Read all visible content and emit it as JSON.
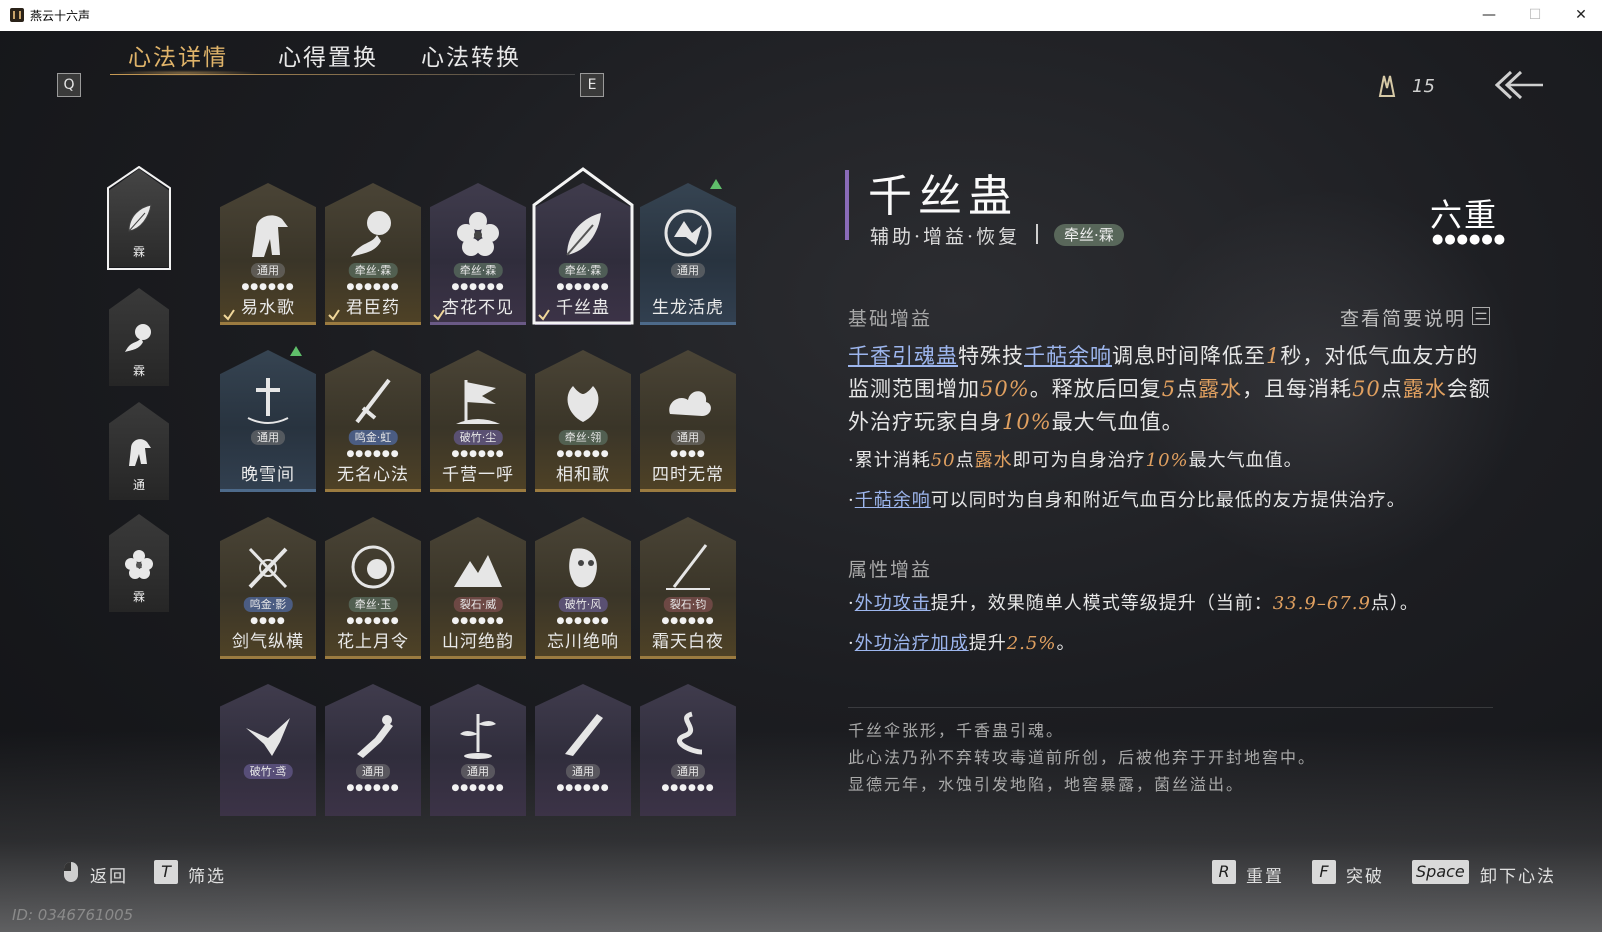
{
  "window": {
    "title": "燕云十六声",
    "minimize": "—",
    "maximize": "☐",
    "close": "✕"
  },
  "nav": {
    "key_left": "Q",
    "key_right": "E",
    "tabs": [
      {
        "label": "心法详情",
        "active": true
      },
      {
        "label": "心得置换",
        "active": false
      },
      {
        "label": "心法转换",
        "active": false
      }
    ],
    "currency": "15"
  },
  "left_slots": [
    {
      "label": "霖",
      "icon": "leaf-icon",
      "selected": true
    },
    {
      "label": "霖",
      "icon": "pouring-jar-icon",
      "selected": false
    },
    {
      "label": "通",
      "icon": "horse-icon",
      "selected": false
    },
    {
      "label": "霖",
      "icon": "flower-icon",
      "selected": false
    }
  ],
  "cards": [
    {
      "name": "易水歌",
      "tag": "通用",
      "dots": "●●●●●●",
      "icon": "horse-icon",
      "color": "gold",
      "tagc": "",
      "check": true
    },
    {
      "name": "君臣药",
      "tag": "牵丝·霖",
      "dots": "●●●●●●",
      "icon": "pouring-jar-icon",
      "color": "gold",
      "tagc": "green",
      "check": true
    },
    {
      "name": "杏花不见",
      "tag": "牵丝·霖",
      "dots": "●●●●●●",
      "icon": "flower-icon",
      "color": "purple",
      "tagc": "green",
      "check": true
    },
    {
      "name": "千丝蛊",
      "tag": "牵丝·霖",
      "dots": "●●●●●●",
      "icon": "leaf-icon",
      "color": "purple",
      "tagc": "green",
      "check": true,
      "selected": true
    },
    {
      "name": "生龙活虎",
      "tag": "通用",
      "dots": "",
      "icon": "dragon-emblem-icon",
      "color": "blue",
      "tagc": "",
      "up": true
    },
    {
      "name": "晚雪间",
      "tag": "通用",
      "dots": "",
      "icon": "sword-in-ground-icon",
      "color": "blue",
      "tagc": "",
      "up": true
    },
    {
      "name": "无名心法",
      "tag": "鸣金·虹",
      "dots": "●●●●●●",
      "icon": "sword-icon",
      "color": "gold",
      "tagc": "blue"
    },
    {
      "name": "千营一呼",
      "tag": "破竹·尘",
      "dots": "●●●●●●",
      "icon": "banner-icon",
      "color": "gold",
      "tagc": "violet"
    },
    {
      "name": "相和歌",
      "tag": "牵丝·翎",
      "dots": "●●●●●●",
      "icon": "phoenix-icon",
      "color": "gold",
      "tagc": "green"
    },
    {
      "name": "四时无常",
      "tag": "通用",
      "dots": "●●●●",
      "icon": "cloud-icon",
      "color": "gold",
      "tagc": ""
    },
    {
      "name": "剑气纵横",
      "tag": "鸣金·影",
      "dots": "●●●●",
      "icon": "crossed-swords-icon",
      "color": "gold",
      "tagc": "blue"
    },
    {
      "name": "花上月令",
      "tag": "牵丝·玉",
      "dots": "●●●●●●",
      "icon": "moon-flower-icon",
      "color": "gold",
      "tagc": "green"
    },
    {
      "name": "山河绝韵",
      "tag": "裂石·威",
      "dots": "●●●●●●",
      "icon": "mountain-icon",
      "color": "gold",
      "tagc": "red"
    },
    {
      "name": "忘川绝响",
      "tag": "破竹·风",
      "dots": "●●●●●●",
      "icon": "mask-icon",
      "color": "gold",
      "tagc": "violet"
    },
    {
      "name": "霜天白夜",
      "tag": "裂石·钧",
      "dots": "●●●●●●",
      "icon": "spear-icon",
      "color": "gold",
      "tagc": "red"
    },
    {
      "name": "",
      "tag": "破竹·鸢",
      "dots": "",
      "icon": "eagle-icon",
      "color": "purple",
      "tagc": "violet"
    },
    {
      "name": "",
      "tag": "通用",
      "dots": "●●●●●●",
      "icon": "bird-hand-icon",
      "color": "purple",
      "tagc": ""
    },
    {
      "name": "",
      "tag": "通用",
      "dots": "●●●●●●",
      "icon": "bamboo-icon",
      "color": "purple",
      "tagc": ""
    },
    {
      "name": "",
      "tag": "通用",
      "dots": "●●●●●●",
      "icon": "blade-icon",
      "color": "purple",
      "tagc": ""
    },
    {
      "name": "",
      "tag": "通用",
      "dots": "●●●●●●",
      "icon": "serpent-dragon-icon",
      "color": "purple",
      "tagc": ""
    }
  ],
  "detail": {
    "name": "千丝蛊",
    "types": "辅助·增益·恢复",
    "school": "牵丝·霖",
    "tier": "六重",
    "tier_dots": "●●●●●●",
    "base_title": "基础增益",
    "view_brief": "查看简要说明",
    "base_text": {
      "l1": "千香引魂蛊",
      "t1": "特殊技",
      "l2": "千萜余响",
      "t2": "调息时间降低至",
      "v1": "1",
      "t3": "秒，对低气血友方的监测范围增加",
      "v2": "50%",
      "t4": "。释放后回复",
      "v3": "5",
      "t5": "点",
      "d1": "露水",
      "t6": "，且每消耗",
      "v4": "50",
      "t7": "点",
      "d2": "露水",
      "t8": "会额外治疗玩家自身",
      "v5": "10%",
      "t9": "最大气血值。"
    },
    "bullet1": {
      "t1": "·累计消耗",
      "v1": "50",
      "t2": "点",
      "d1": "露水",
      "t3": "即可为自身治疗",
      "v2": "10%",
      "t4": "最大气血值。"
    },
    "bullet2": {
      "t0": "·",
      "l1": "千萜余响",
      "t1": "可以同时为自身和附近气血百分比最低的友方提供治疗。"
    },
    "attr_title": "属性增益",
    "attr1": {
      "t0": "·",
      "l1": "外功攻击",
      "t1": "提升，效果随单人模式等级提升（当前：",
      "v1": "33.9–67.9",
      "t2": "点）。"
    },
    "attr2": {
      "t0": "·",
      "l1": "外功治疗加成",
      "t1": "提升",
      "v1": "2.5%",
      "t2": "。"
    },
    "lore": [
      "千丝伞张形，千香蛊引魂。",
      "此心法乃孙不弃转攻毒道前所创，后被他弃于开封地窖中。",
      "显德元年，水蚀引发地陷，地窖暴露，菌丝溢出。"
    ]
  },
  "footer": {
    "back": "返回",
    "filter_key": "T",
    "filter": "筛选",
    "reset_key": "R",
    "reset": "重置",
    "break_key": "F",
    "break": "突破",
    "unload_key": "Space",
    "unload": "卸下心法",
    "uid": "ID: 0346761005"
  },
  "colors": {
    "accent_gold": "#e0b46a",
    "link_blue": "#9db6ee",
    "value_orange": "#e0a060",
    "school_purple": "#8a6bb8"
  }
}
